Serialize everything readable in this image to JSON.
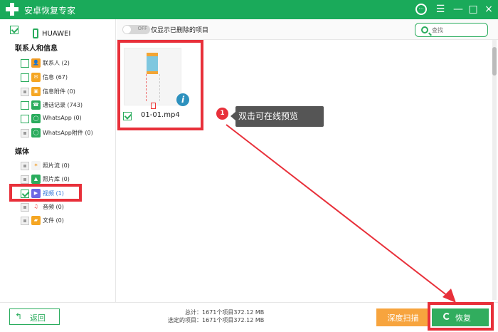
{
  "app": {
    "title": "安卓恢复专家",
    "window_controls": [
      "chat-icon",
      "menu-icon",
      "minimize-icon",
      "maximize-icon",
      "close-icon"
    ],
    "brand_color": "#1aaa5a"
  },
  "sidebar": {
    "device": "HUAWEI",
    "section_contacts": "联系人和信息",
    "section_media": "媒体",
    "items": [
      {
        "label": "联系人 (2)",
        "icon": "contacts-icon",
        "checked": false
      },
      {
        "label": "信息 (67)",
        "icon": "message-icon",
        "checked": false
      },
      {
        "label": "信息附件 (0)",
        "icon": "attachment-icon",
        "checked": false
      },
      {
        "label": "通话记录 (743)",
        "icon": "phone-call-icon",
        "checked": false
      },
      {
        "label": "WhatsApp (0)",
        "icon": "whatsapp-icon",
        "checked": false
      },
      {
        "label": "WhatsApp附件 (0)",
        "icon": "whatsapp-attachment-icon",
        "checked": false
      },
      {
        "label": "照片流 (0)",
        "icon": "photo-stream-icon",
        "checked": false
      },
      {
        "label": "照片库 (0)",
        "icon": "photo-library-icon",
        "checked": false
      },
      {
        "label": "视频 (1)",
        "icon": "video-icon",
        "checked": true
      },
      {
        "label": "音频 (0)",
        "icon": "audio-icon",
        "checked": false
      },
      {
        "label": "文件 (0)",
        "icon": "folder-icon",
        "checked": false
      }
    ]
  },
  "main": {
    "toggle_state": "OFF",
    "toggle_label": "仅显示已删除的项目",
    "search_placeholder": "查找",
    "file": {
      "name": "01-01.mp4",
      "info": "i"
    },
    "callout_number": "1",
    "callout_text": "双击可在线预览"
  },
  "bottom": {
    "back_label": "返回",
    "stats_line1": "总计：1671个项目372.12 MB",
    "stats_line2": "选定的项目：1671个项目372.12 MB",
    "deep_scan": "深度扫描",
    "recover": "恢复"
  },
  "colors": {
    "highlight": "#e8303a",
    "recover": "#31ad5e",
    "deep_scan": "#f7a43e"
  }
}
